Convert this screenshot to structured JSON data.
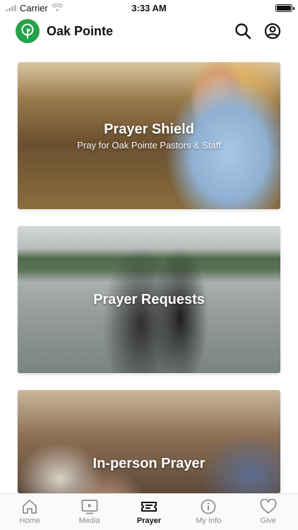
{
  "status_bar": {
    "carrier": "Carrier",
    "time": "3:33 AM"
  },
  "header": {
    "app_name": "Oak Pointe"
  },
  "cards": [
    {
      "title": "Prayer Shield",
      "subtitle": "Pray for Oak Pointe Pastors & Staff"
    },
    {
      "title": "Prayer Requests"
    },
    {
      "title": "In-person Prayer"
    }
  ],
  "tabbar": {
    "active": "Prayer",
    "items": [
      {
        "label": "Home",
        "icon": "home-icon"
      },
      {
        "label": "Media",
        "icon": "tv-play-icon"
      },
      {
        "label": "Prayer",
        "icon": "ticket-icon"
      },
      {
        "label": "My Info",
        "icon": "info-icon"
      },
      {
        "label": "Give",
        "icon": "heart-icon"
      }
    ]
  },
  "colors": {
    "brand": "#25a249",
    "tab_inactive": "#8e8e8e",
    "tab_active": "#111111"
  }
}
